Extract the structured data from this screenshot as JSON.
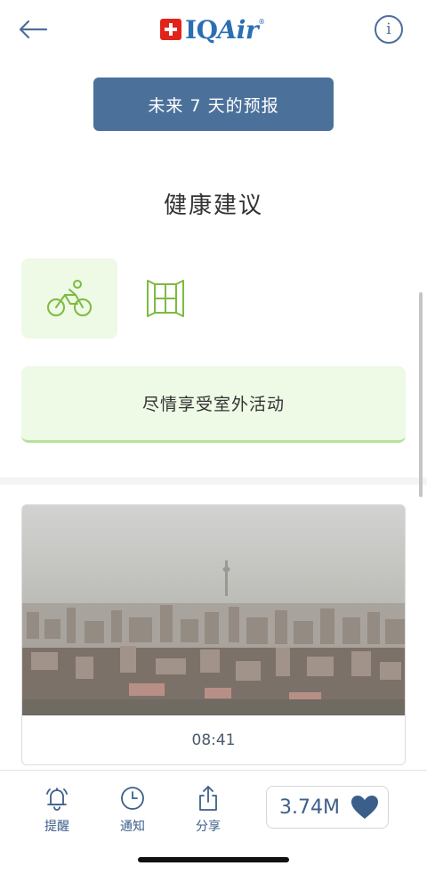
{
  "header": {
    "logo_text_iq": "IQ",
    "logo_text_air": "Air",
    "logo_reg": "®",
    "info_glyph": "i"
  },
  "forecast_button": {
    "label": "未来 7 天的预报"
  },
  "health": {
    "title": "健康建议",
    "icons": [
      "bicycle-icon",
      "window-icon"
    ],
    "advice": "尽情享受室外活动"
  },
  "photo": {
    "time": "08:41"
  },
  "tabbar": {
    "items": [
      {
        "icon": "bell-icon",
        "label": "提醒"
      },
      {
        "icon": "clock-icon",
        "label": "通知"
      },
      {
        "icon": "share-icon",
        "label": "分享"
      }
    ],
    "likes": "3.74M",
    "like_icon": "heart-icon"
  },
  "colors": {
    "accent_blue": "#4b719b",
    "logo_red": "#e2231a",
    "good_green_bg": "#eef9e6",
    "good_green_line": "#b6e19b",
    "icon_green": "#7dbb3f"
  }
}
